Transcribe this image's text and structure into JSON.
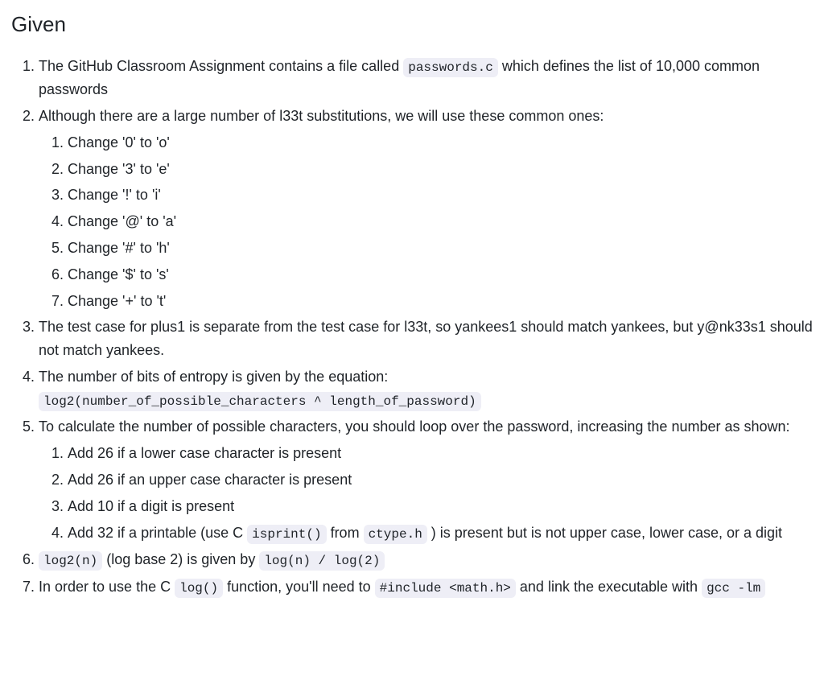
{
  "heading": "Given",
  "items": {
    "i1": {
      "prefix": "The GitHub Classroom Assignment contains a file called ",
      "code1": "passwords.c",
      "suffix": " which defines the list of 10,000 common passwords"
    },
    "i2": {
      "text": "Although there are a large number of l33t substitutions, we will use these common ones:",
      "subs": [
        "Change '0' to 'o'",
        "Change '3' to 'e'",
        "Change '!' to 'i'",
        "Change '@' to 'a'",
        "Change '#' to 'h'",
        "Change '$' to 's'",
        "Change '+' to 't'"
      ]
    },
    "i3": "The test case for plus1 is separate from the test case for l33t, so yankees1 should match yankees, but y@nk33s1 should not match yankees.",
    "i4": {
      "prefix": "The number of bits of entropy is given by the equation:",
      "code1": "log2(number_of_possible_characters ^ length_of_password)"
    },
    "i5": {
      "text": "To calculate the number of possible characters, you should loop over the password, increasing the number as shown:",
      "s1": "Add 26 if a lower case character is present",
      "s2": "Add 26 if an upper case character is present",
      "s3": "Add 10 if a digit is present",
      "s4": {
        "a": "Add 32 if a printable (use C ",
        "code1": "isprint()",
        "b": " from ",
        "code2": "ctype.h",
        "c": " ) is present but is not upper case, lower case, or a digit"
      }
    },
    "i6": {
      "code1": "log2(n)",
      "a": " (log base 2) is given by ",
      "code2": "log(n) / log(2)"
    },
    "i7": {
      "a": "In order to use the C ",
      "code1": "log()",
      "b": " function, you'll need to ",
      "code2": "#include <math.h>",
      "c": " and link the executable with ",
      "code3": "gcc -lm"
    }
  }
}
